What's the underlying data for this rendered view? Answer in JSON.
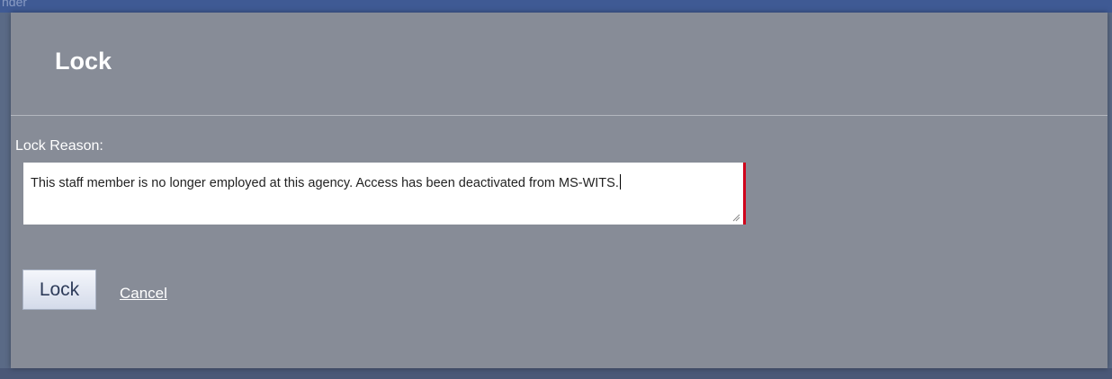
{
  "background": {
    "topbar_text": "nder"
  },
  "dialog": {
    "title": "Lock",
    "field_label": "Lock Reason:",
    "reason_value": "This staff member is no longer employed at this agency. Access has been deactivated from MS-WITS.",
    "lock_button_label": "Lock",
    "cancel_link_label": "Cancel"
  },
  "colors": {
    "dialog_bg": "#878c97",
    "required_marker": "#d0021b",
    "overlay_bg": "#5a6a86"
  }
}
